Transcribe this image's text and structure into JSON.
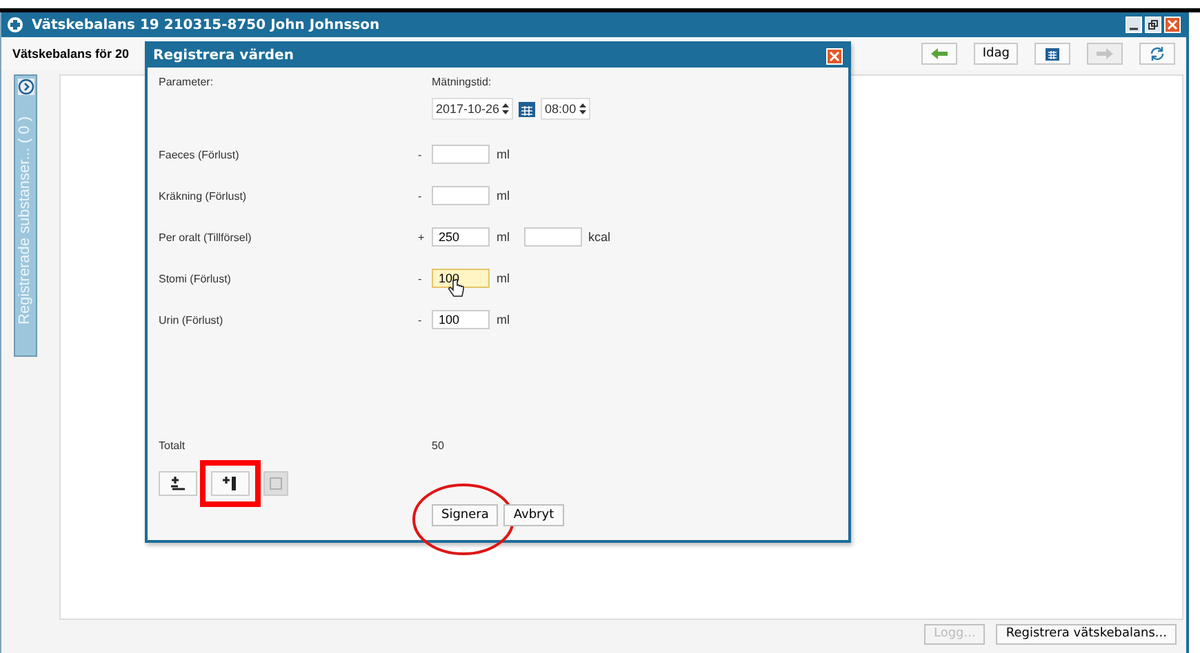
{
  "window": {
    "title": "Vätskebalans 19 210315-8750 John Johnsson"
  },
  "toolbar": {
    "heading": "Vätskebalans för 20",
    "buttons": [
      {
        "kind": "back",
        "disabled": false
      },
      {
        "kind": "text",
        "label": "Idag",
        "disabled": false
      },
      {
        "kind": "calendar",
        "disabled": false
      },
      {
        "kind": "forward",
        "disabled": true
      },
      {
        "kind": "refresh",
        "disabled": false
      }
    ]
  },
  "sidebar": {
    "label": "Registrerade substanser... ( 0 )",
    "expanded": false
  },
  "dialog": {
    "title": "Registrera värden",
    "parameter_label": "Parameter:",
    "time_label": "Mätningstid:",
    "date": "2017-10-26",
    "time": "08:00",
    "rows": [
      {
        "label": "Faeces (Förlust)",
        "sign": "-",
        "value": "",
        "unit": "ml",
        "focused": false
      },
      {
        "label": "Kräkning (Förlust)",
        "sign": "-",
        "value": "",
        "unit": "ml",
        "focused": false
      },
      {
        "label": "Per oralt (Tillförsel)",
        "sign": "+",
        "value": "250",
        "unit": "ml",
        "focused": false,
        "kcal": {
          "unit": "kcal"
        }
      },
      {
        "label": "Stomi (Förlust)",
        "sign": "-",
        "value": "100",
        "unit": "ml",
        "focused": true
      },
      {
        "label": "Urin (Förlust)",
        "sign": "-",
        "value": "100",
        "unit": "ml",
        "focused": false
      }
    ],
    "total_label": "Totalt",
    "total": "50",
    "tools": [
      {
        "kind": "balance",
        "disabled": false,
        "highlighted": false
      },
      {
        "kind": "add",
        "disabled": false,
        "highlighted": true
      },
      {
        "kind": "other",
        "disabled": true,
        "highlighted": false
      }
    ],
    "buttons": [
      {
        "label": "Signera",
        "highlighted": true
      },
      {
        "label": "Avbryt",
        "highlighted": false
      }
    ]
  },
  "footer_buttons": [
    {
      "label": "Logg...",
      "disabled": true
    },
    {
      "label": "Registrera vätskebalans...",
      "disabled": false
    }
  ]
}
